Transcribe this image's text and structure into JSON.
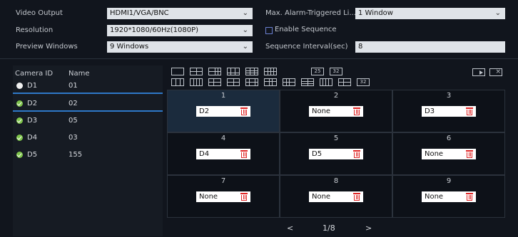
{
  "settings": {
    "video_output": {
      "label": "Video Output",
      "value": "HDMI1/VGA/BNC"
    },
    "resolution": {
      "label": "Resolution",
      "value": "1920*1080/60Hz(1080P)"
    },
    "preview_windows": {
      "label": "Preview Windows",
      "value": "9 Windows"
    },
    "alarm_triggered": {
      "label": "Max. Alarm-Triggered Li...",
      "value": "1 Window"
    },
    "enable_sequence": {
      "label": "Enable Sequence",
      "checked": false
    },
    "sequence_interval": {
      "label": "Sequence Interval(sec)",
      "value": "8"
    }
  },
  "camera_list": {
    "headers": {
      "id": "Camera ID",
      "name": "Name"
    },
    "rows": [
      {
        "id": "D1",
        "name": "01",
        "status": "unassigned"
      },
      {
        "id": "D2",
        "name": "02",
        "status": "assigned"
      },
      {
        "id": "D3",
        "name": "05",
        "status": "assigned"
      },
      {
        "id": "D4",
        "name": "03",
        "status": "assigned"
      },
      {
        "id": "D5",
        "name": "155",
        "status": "assigned"
      }
    ]
  },
  "layout_icons": {
    "row1": [
      "1",
      "4",
      "6",
      "8",
      "9",
      "16",
      "25",
      "32"
    ],
    "row2_labels": [
      "32"
    ],
    "icon25": "25",
    "icon32": "32"
  },
  "grid": {
    "cells": [
      {
        "num": "1",
        "value": "D2",
        "active": true
      },
      {
        "num": "2",
        "value": "None"
      },
      {
        "num": "3",
        "value": "D3"
      },
      {
        "num": "4",
        "value": "D4"
      },
      {
        "num": "5",
        "value": "D5"
      },
      {
        "num": "6",
        "value": "None"
      },
      {
        "num": "7",
        "value": "None"
      },
      {
        "num": "8",
        "value": "None"
      },
      {
        "num": "9",
        "value": "None"
      }
    ]
  },
  "pager": {
    "prev": "<",
    "page": "1/8",
    "next": ">"
  },
  "colors": {
    "background": "#11151d",
    "accent": "#2e78c8",
    "delete": "#e02424",
    "online": "#7ec44a"
  }
}
